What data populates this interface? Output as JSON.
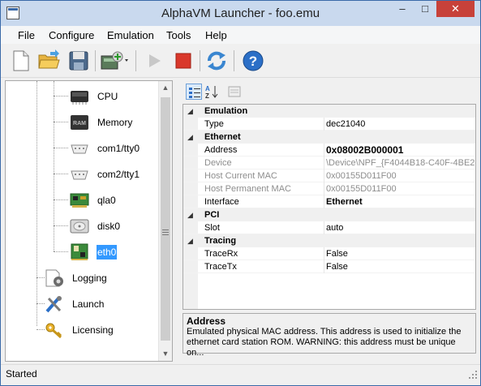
{
  "window": {
    "title": "AlphaVM Launcher - foo.emu",
    "controls": {
      "minimize": "–",
      "maximize": "□",
      "close": "✕"
    }
  },
  "menu": {
    "items": [
      "File",
      "Configure",
      "Emulation",
      "Tools",
      "Help"
    ]
  },
  "toolbar": {
    "buttons": [
      "new-icon",
      "open-folder-icon",
      "save-icon",
      "add-device-icon",
      "play-icon",
      "stop-icon",
      "refresh-icon",
      "help-icon"
    ]
  },
  "tree": {
    "items": [
      {
        "label": "CPU",
        "icon": "cpu-icon"
      },
      {
        "label": "Memory",
        "icon": "memory-icon"
      },
      {
        "label": "com1/tty0",
        "icon": "serial-port-icon"
      },
      {
        "label": "com2/tty1",
        "icon": "serial-port-icon"
      },
      {
        "label": "qla0",
        "icon": "scsi-card-icon"
      },
      {
        "label": "disk0",
        "icon": "disk-icon"
      },
      {
        "label": "eth0",
        "icon": "network-card-icon",
        "selected": true
      },
      {
        "label": "Logging",
        "icon": "logging-icon"
      },
      {
        "label": "Launch",
        "icon": "launch-tools-icon"
      },
      {
        "label": "Licensing",
        "icon": "key-icon"
      }
    ]
  },
  "propgrid": {
    "categories": [
      {
        "name": "Emulation",
        "props": [
          {
            "name": "Type",
            "value": "dec21040"
          }
        ]
      },
      {
        "name": "Ethernet",
        "props": [
          {
            "name": "Address",
            "value": "0x08002B000001"
          },
          {
            "name": "Device",
            "value": "\\Device\\NPF_{F4044B18-C40F-4BE2-"
          },
          {
            "name": "Host Current MAC",
            "value": "0x00155D011F00"
          },
          {
            "name": "Host Permanent MAC",
            "value": "0x00155D011F00"
          },
          {
            "name": "Interface",
            "value": "Ethernet"
          }
        ]
      },
      {
        "name": "PCI",
        "props": [
          {
            "name": "Slot",
            "value": "auto"
          }
        ]
      },
      {
        "name": "Tracing",
        "props": [
          {
            "name": "TraceRx",
            "value": "False"
          },
          {
            "name": "TraceTx",
            "value": "False"
          }
        ]
      }
    ],
    "description": {
      "title": "Address",
      "text": "Emulated physical MAC address. This address is used to initialize the ethernet card station ROM. WARNING: this address must be unique on..."
    }
  },
  "status": {
    "text": "Started"
  },
  "colors": {
    "selection": "#3399ff",
    "stop": "#d9382b",
    "close": "#c7413a",
    "titlebar": "#c9d9ee"
  }
}
